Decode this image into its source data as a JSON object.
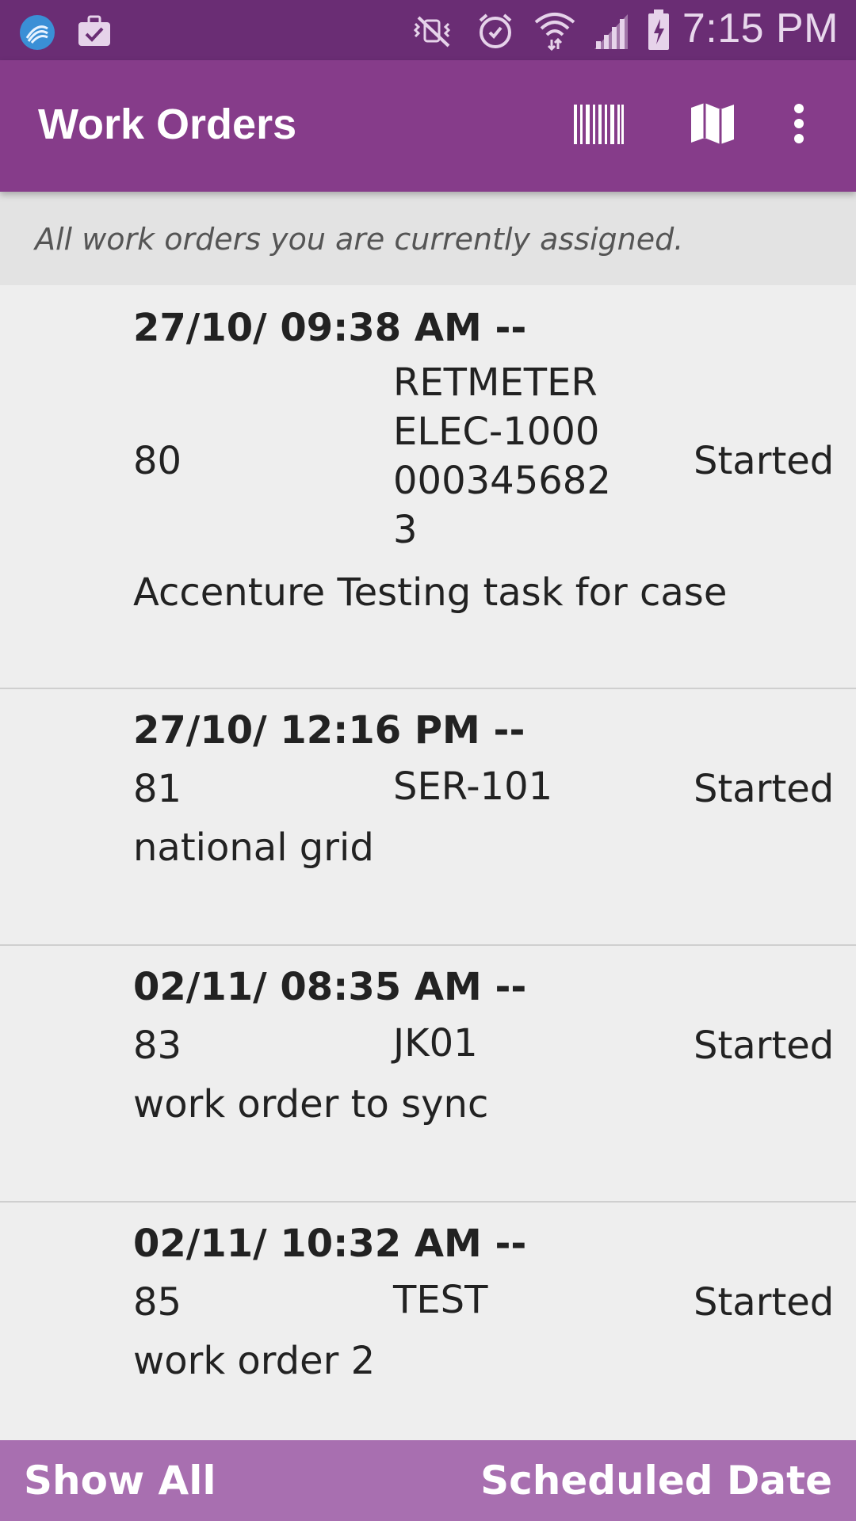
{
  "status_bar": {
    "time": "7:15 PM",
    "icons": [
      "app-logo-icon",
      "briefcase-check-icon",
      "mute-vibrate-icon",
      "alarm-icon",
      "wifi-icon",
      "signal-icon",
      "battery-charging-icon"
    ]
  },
  "app_bar": {
    "title": "Work Orders",
    "actions": [
      "barcode-icon",
      "map-icon",
      "more-vert-icon"
    ],
    "color": "#863c8a"
  },
  "subtitle": "All work orders you are currently assigned.",
  "work_orders": [
    {
      "datetime": "27/10/ 09:38 AM --",
      "number": "80",
      "code_lines": [
        "RETMETER",
        "ELEC-1000",
        "000345682",
        "3"
      ],
      "status": "Started",
      "description": "Accenture Testing task for case"
    },
    {
      "datetime": "27/10/ 12:16 PM --",
      "number": "81",
      "code_lines": [
        "SER-101"
      ],
      "status": "Started",
      "description": "national grid"
    },
    {
      "datetime": "02/11/ 08:35 AM --",
      "number": "83",
      "code_lines": [
        "JK01"
      ],
      "status": "Started",
      "description": "work order to sync"
    },
    {
      "datetime": "02/11/ 10:32 AM --",
      "number": "85",
      "code_lines": [
        "TEST"
      ],
      "status": "Started",
      "description": "work order 2"
    }
  ],
  "bottom_bar": {
    "left_label": "Show All",
    "right_label": "Scheduled Date",
    "color": "#a86fb0"
  }
}
